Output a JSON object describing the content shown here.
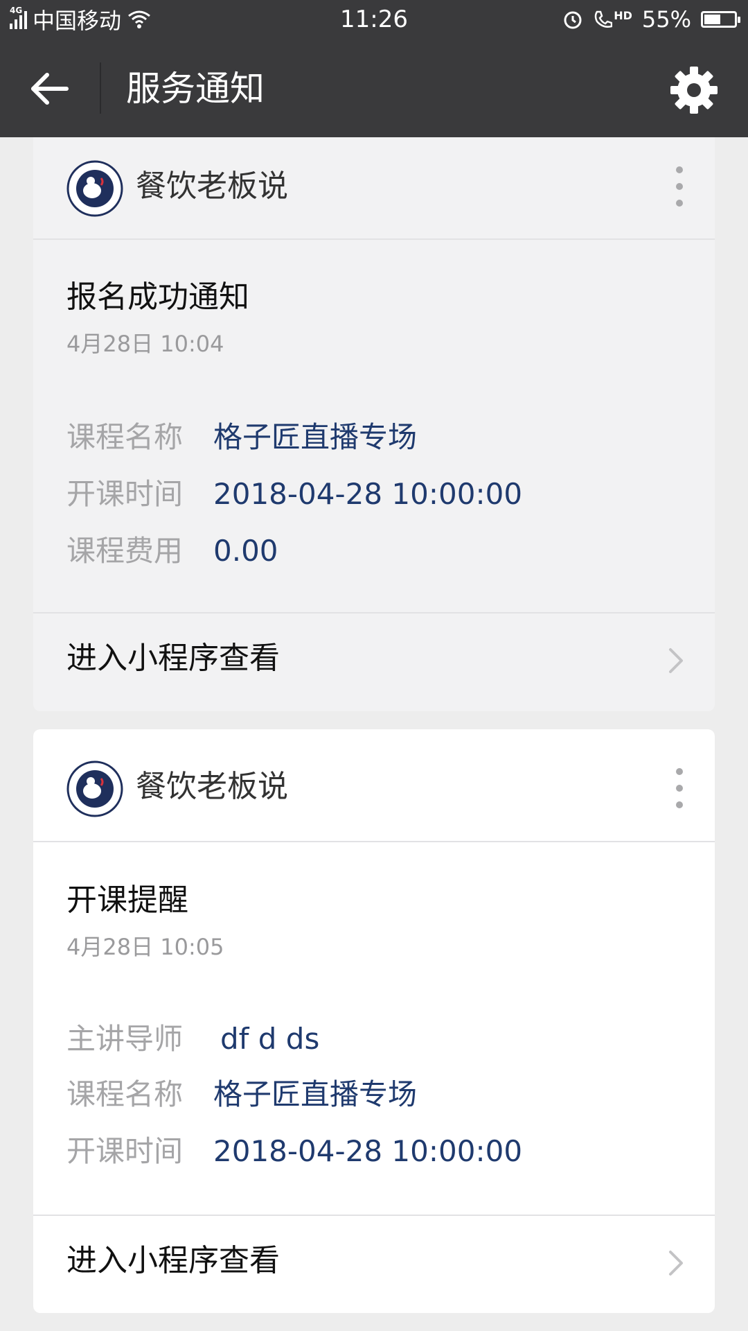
{
  "status_bar": {
    "network": "4G",
    "carrier": "中国移动",
    "time": "11:26",
    "call_badge": "HD",
    "battery_percent": "55%",
    "battery_level": 0.55
  },
  "nav": {
    "title": "服务通知",
    "icons": {
      "back": "back-arrow-icon",
      "settings": "gear-icon"
    }
  },
  "cards": [
    {
      "brand": "餐饮老板说",
      "title": "报名成功通知",
      "time": "4月28日  10:04",
      "fields": [
        {
          "key": "课程名称",
          "value": "格子匠直播专场"
        },
        {
          "key": "开课时间",
          "value": "2018-04-28 10:00:00"
        },
        {
          "key": "课程费用",
          "value": "0.00"
        }
      ],
      "action": "进入小程序查看"
    },
    {
      "brand": "餐饮老板说",
      "title": "开课提醒",
      "time": "4月28日  10:05",
      "fields": [
        {
          "key": "主讲导师",
          "value": "df d ds"
        },
        {
          "key": "课程名称",
          "value": "格子匠直播专场"
        },
        {
          "key": "开课时间",
          "value": "2018-04-28 10:00:00"
        }
      ],
      "action": "进入小程序查看"
    }
  ],
  "colors": {
    "bar_bg": "#3a3a3c",
    "value_text": "#1f3a6e",
    "label_text": "#a5a5a7",
    "page_bg": "#ededed"
  }
}
